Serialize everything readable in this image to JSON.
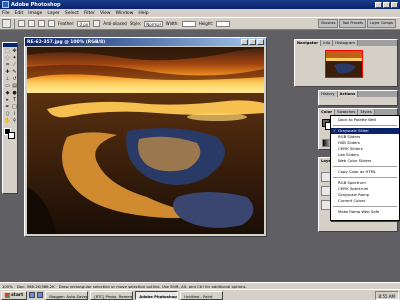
{
  "app": {
    "title": "Adobe Photoshop"
  },
  "menubar": [
    "File",
    "Edit",
    "Image",
    "Layer",
    "Select",
    "Filter",
    "View",
    "Window",
    "Help"
  ],
  "options": {
    "feather_label": "Feather:",
    "feather_value": "0 px",
    "antialiased_label": "Anti-aliased",
    "style_label": "Style:",
    "style_value": "Normal",
    "width_label": "Width:",
    "height_label": "Height:"
  },
  "palette_well": {
    "brushes": "Brushes",
    "tool_presets": "Tool Presets",
    "layer_comps": "Layer Comps"
  },
  "document": {
    "title": "RE-62-357.jpg @ 100% (RGB/8)"
  },
  "navigator": {
    "tabs": [
      "Navigator",
      "Info",
      "Histogram"
    ]
  },
  "history": {
    "tabs": [
      "History",
      "Actions"
    ]
  },
  "color_panel": {
    "tabs": [
      "Color",
      "Swatches",
      "Styles"
    ]
  },
  "layers_panel": {
    "tab": "Layers"
  },
  "color_menu": {
    "items": [
      {
        "label": "Dock to Palette Well",
        "selected": false
      },
      {
        "sep": true
      },
      {
        "label": "Grayscale Slider",
        "selected": true
      },
      {
        "label": "RGB Sliders",
        "selected": false
      },
      {
        "label": "HSB Sliders",
        "selected": false
      },
      {
        "label": "CMYK Sliders",
        "selected": false
      },
      {
        "label": "Lab Sliders",
        "selected": false
      },
      {
        "label": "Web Color Sliders",
        "selected": false
      },
      {
        "sep": true
      },
      {
        "label": "Copy Color as HTML",
        "selected": false
      },
      {
        "sep": true
      },
      {
        "label": "RGB Spectrum",
        "selected": false
      },
      {
        "label": "CMYK Spectrum",
        "selected": false
      },
      {
        "label": "Grayscale Ramp",
        "selected": false
      },
      {
        "label": "Current Colors",
        "selected": false
      },
      {
        "sep": true
      },
      {
        "label": "Make Ramp Web Safe",
        "selected": false
      }
    ]
  },
  "status": {
    "zoom": "100%",
    "doc": "Doc: 366.2K/366.2K",
    "hint": "Draw rectangular selection or move selection outline. Use Shift, Alt, and Ctrl for additional options."
  },
  "taskbar": {
    "start": "start",
    "tasks": [
      "Blogger: Auto-Savepro...",
      "[RTC] Photo, Remember...",
      "Adobe Photoshop",
      "Untitled - Paint"
    ],
    "active_index": 2,
    "clock": "8:55 AM"
  },
  "colors": {
    "titlebar": "#0a246a",
    "chrome": "#d4d0c8",
    "workspace": "#606064"
  }
}
